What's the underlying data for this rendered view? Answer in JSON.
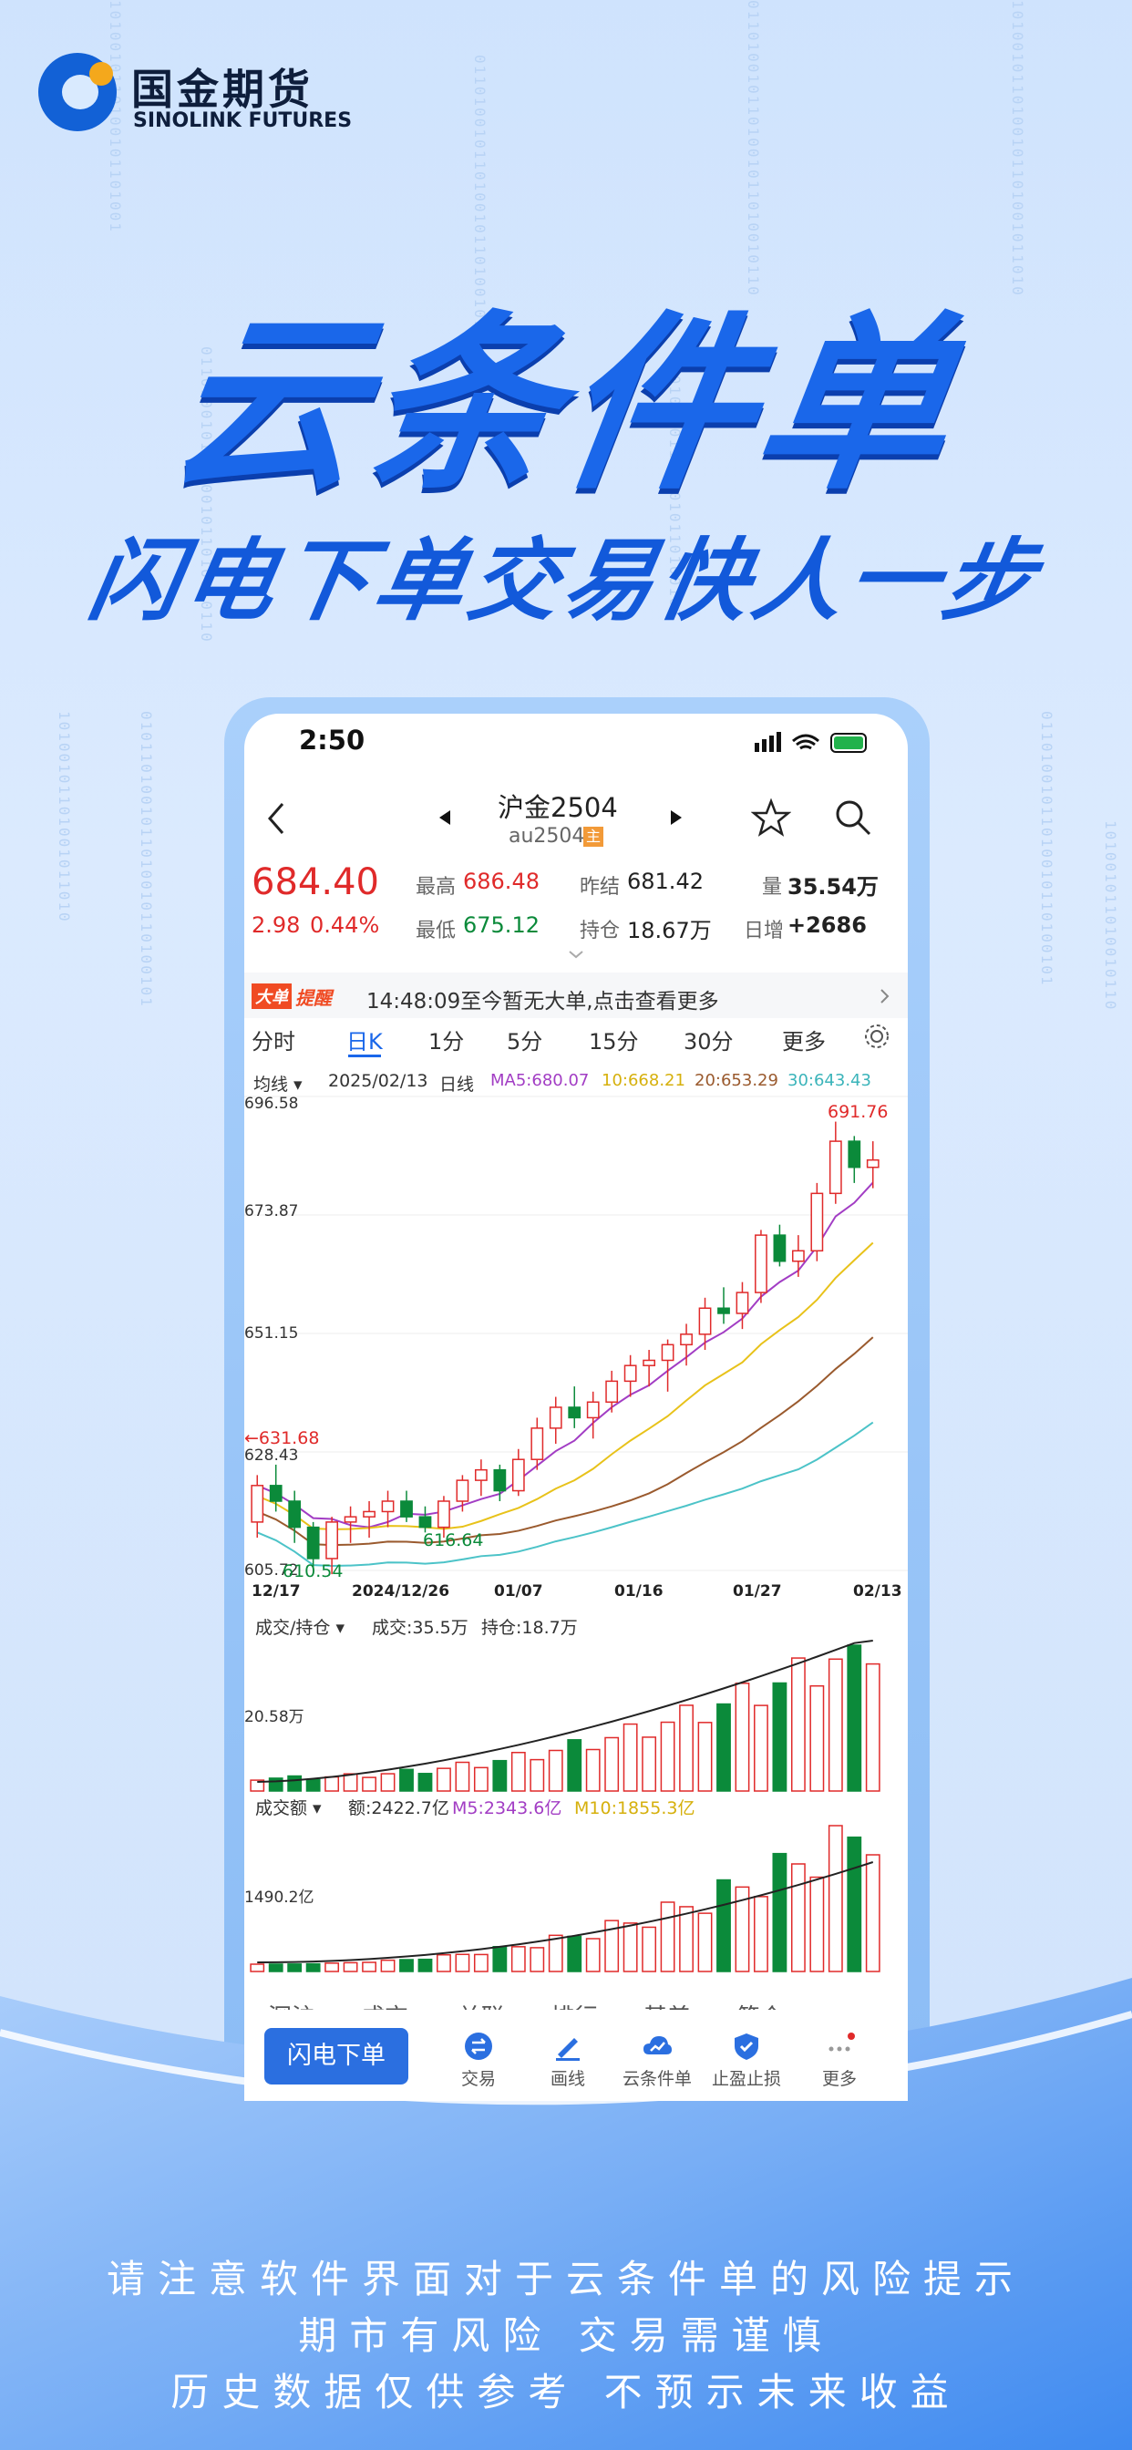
{
  "brand": {
    "name_cn": "国金期货",
    "name_en": "SINOLINK FUTURES"
  },
  "headline": "云条件单",
  "subline": "闪电下单交易快人一步",
  "phone": {
    "status_time": "2:50",
    "nav": {
      "title": "沪金2504",
      "code": "au2504",
      "main_tag": "主"
    },
    "quote": {
      "price": "684.40",
      "change": "2.98",
      "change_pct": "0.44%",
      "high_label": "最高",
      "high": "686.48",
      "low_label": "最低",
      "low": "675.12",
      "prev_settle_label": "昨结",
      "prev_settle": "681.42",
      "oi_label": "持仓",
      "oi": "18.67万",
      "vol_label": "量",
      "vol": "35.54万",
      "oi_chg_label": "日增",
      "oi_chg": "+2686"
    },
    "alert": {
      "tag_a": "大单",
      "tag_b": "提醒",
      "text": "14:48:09至今暂无大单,点击查看更多"
    },
    "tabs": [
      "分时",
      "日K",
      "1分",
      "5分",
      "15分",
      "30分",
      "更多"
    ],
    "active_tab": "日K",
    "ma_line": {
      "mode": "均线",
      "date": "2025/02/13",
      "period": "日线",
      "ma5": "MA5:680.07",
      "ma10": "10:668.21",
      "ma20": "20:653.29",
      "ma30": "30:643.43"
    },
    "y_labels": [
      "696.58",
      "673.87",
      "651.15",
      "628.43",
      "605.72"
    ],
    "x_labels": [
      "12/17",
      "2024/12/26",
      "01/07",
      "01/16",
      "01/27",
      "02/13"
    ],
    "annotations": {
      "high": "691.76",
      "mid": "631.68",
      "low1": "610.54",
      "low2": "616.64"
    },
    "vol_panel": {
      "mode": "成交/持仓",
      "vol": "成交:35.5万",
      "oi": "持仓:18.7万",
      "ylabel": "20.58万"
    },
    "amt_panel": {
      "mode": "成交额",
      "amt": "额:2422.7亿",
      "m5": "M5:2343.6亿",
      "m10": "M10:1855.3亿",
      "ylabel": "1490.2亿"
    },
    "cut_labels": [
      "深沪",
      "成交",
      "关联",
      "排行",
      "基差",
      "简介"
    ],
    "toolbar": {
      "flash_order": "闪电下单",
      "items": [
        "交易",
        "画线",
        "云条件单",
        "止盈止损",
        "更多"
      ]
    }
  },
  "colors": {
    "up": "#e02a2a",
    "down": "#0b8a3a",
    "accent": "#1a67ea",
    "ma5": "#a23dc4",
    "ma10": "#e8c21a",
    "ma20": "#9a5a2e",
    "ma30": "#4cc3c8"
  },
  "disclaimer": [
    "请注意软件界面对于云条件单的风险提示",
    "期市有风险 交易需谨慎",
    "历史数据仅供参考 不预示未来收益"
  ],
  "chart_data": {
    "type": "candlestick",
    "series_ohlc": [
      [
        615,
        624,
        612,
        622
      ],
      [
        622,
        626,
        617,
        619
      ],
      [
        619,
        621,
        611,
        614
      ],
      [
        614,
        615,
        606,
        608
      ],
      [
        608,
        616,
        605,
        615
      ],
      [
        615,
        618,
        611,
        616
      ],
      [
        616,
        619,
        612,
        617
      ],
      [
        617,
        621,
        614,
        619
      ],
      [
        619,
        621,
        615,
        616
      ],
      [
        616,
        618,
        613,
        614
      ],
      [
        614,
        620,
        612,
        619
      ],
      [
        619,
        624,
        617,
        623
      ],
      [
        623,
        627,
        620,
        625
      ],
      [
        625,
        626,
        619,
        621
      ],
      [
        621,
        629,
        620,
        627
      ],
      [
        627,
        635,
        625,
        633
      ],
      [
        633,
        639,
        630,
        637
      ],
      [
        637,
        641,
        633,
        635
      ],
      [
        635,
        640,
        631,
        638
      ],
      [
        638,
        644,
        636,
        642
      ],
      [
        642,
        647,
        639,
        645
      ],
      [
        645,
        648,
        641,
        646
      ],
      [
        646,
        650,
        640,
        649
      ],
      [
        649,
        653,
        645,
        651
      ],
      [
        651,
        658,
        648,
        656
      ],
      [
        656,
        660,
        653,
        655
      ],
      [
        655,
        661,
        652,
        659
      ],
      [
        659,
        671,
        657,
        670
      ],
      [
        670,
        672,
        664,
        665
      ],
      [
        665,
        670,
        662,
        667
      ],
      [
        667,
        680,
        665,
        678
      ],
      [
        678,
        691.76,
        676,
        688
      ],
      [
        688,
        689,
        680,
        683
      ],
      [
        683,
        688,
        679,
        684.4
      ]
    ],
    "ma": {
      "ma5": "680.07",
      "ma10": "668.21",
      "ma20": "653.29",
      "ma30": "643.43"
    },
    "ylim": [
      605.72,
      696.58
    ]
  }
}
